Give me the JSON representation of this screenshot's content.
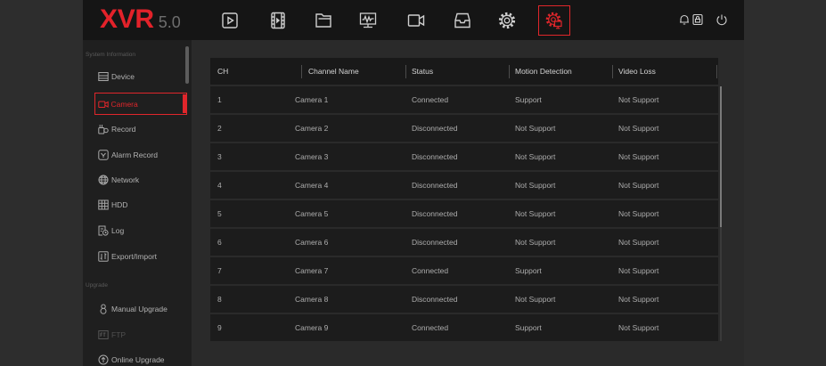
{
  "header": {
    "logo": {
      "brand": "XVR",
      "version": "5.0"
    },
    "toolbar": [
      {
        "icon": "playback-icon"
      },
      {
        "icon": "video-file-icon"
      },
      {
        "icon": "folder-icon"
      },
      {
        "icon": "monitor-chart-icon"
      },
      {
        "icon": "camera-icon"
      },
      {
        "icon": "tray-icon"
      },
      {
        "icon": "gear-icon"
      },
      {
        "icon": "system-settings-icon",
        "active": true
      }
    ],
    "right_icons": [
      "bell-icon",
      "screen-lock-icon",
      "power-icon"
    ]
  },
  "sidebar": {
    "system_information": {
      "title": "System Information",
      "items": [
        {
          "label": "Device",
          "icon": "device-icon"
        },
        {
          "label": "Camera",
          "icon": "camera-icon",
          "active": true
        },
        {
          "label": "Record",
          "icon": "record-icon"
        },
        {
          "label": "Alarm Record",
          "icon": "alarm-record-icon"
        },
        {
          "label": "Network",
          "icon": "network-icon"
        },
        {
          "label": "HDD",
          "icon": "hdd-icon"
        },
        {
          "label": "Log",
          "icon": "log-icon"
        },
        {
          "label": "Export/Import",
          "icon": "export-import-icon"
        }
      ]
    },
    "upgrade": {
      "title": "Upgrade",
      "items": [
        {
          "label": "Manual Upgrade",
          "icon": "manual-upgrade-icon"
        },
        {
          "label": "FTP",
          "icon": "ftp-icon",
          "disabled": true
        },
        {
          "label": "Online Upgrade",
          "icon": "online-upgrade-icon"
        }
      ]
    }
  },
  "table": {
    "columns": {
      "ch": "CH",
      "name": "Channel Name",
      "status": "Status",
      "motion_detection": "Motion Detection",
      "video_loss": "Video Loss"
    },
    "rows": [
      {
        "ch": "1",
        "name": "Camera 1",
        "status": "Connected",
        "motion_detection": "Support",
        "video_loss": "Not Support"
      },
      {
        "ch": "2",
        "name": "Camera 2",
        "status": "Disconnected",
        "motion_detection": "Not Support",
        "video_loss": "Not Support"
      },
      {
        "ch": "3",
        "name": "Camera 3",
        "status": "Disconnected",
        "motion_detection": "Not Support",
        "video_loss": "Not Support"
      },
      {
        "ch": "4",
        "name": "Camera 4",
        "status": "Disconnected",
        "motion_detection": "Not Support",
        "video_loss": "Not Support"
      },
      {
        "ch": "5",
        "name": "Camera 5",
        "status": "Disconnected",
        "motion_detection": "Not Support",
        "video_loss": "Not Support"
      },
      {
        "ch": "6",
        "name": "Camera 6",
        "status": "Disconnected",
        "motion_detection": "Not Support",
        "video_loss": "Not Support"
      },
      {
        "ch": "7",
        "name": "Camera 7",
        "status": "Connected",
        "motion_detection": "Support",
        "video_loss": "Not Support"
      },
      {
        "ch": "8",
        "name": "Camera 8",
        "status": "Disconnected",
        "motion_detection": "Not Support",
        "video_loss": "Not Support"
      },
      {
        "ch": "9",
        "name": "Camera 9",
        "status": "Connected",
        "motion_detection": "Support",
        "video_loss": "Not Support"
      }
    ]
  },
  "colors": {
    "accent": "#e0262b",
    "header_bg": "#151515",
    "sidebar_bg": "#1f1f1f",
    "content_bg": "#2a2a2a",
    "row_bg": "#1c1c1c",
    "text": "#adadad"
  }
}
